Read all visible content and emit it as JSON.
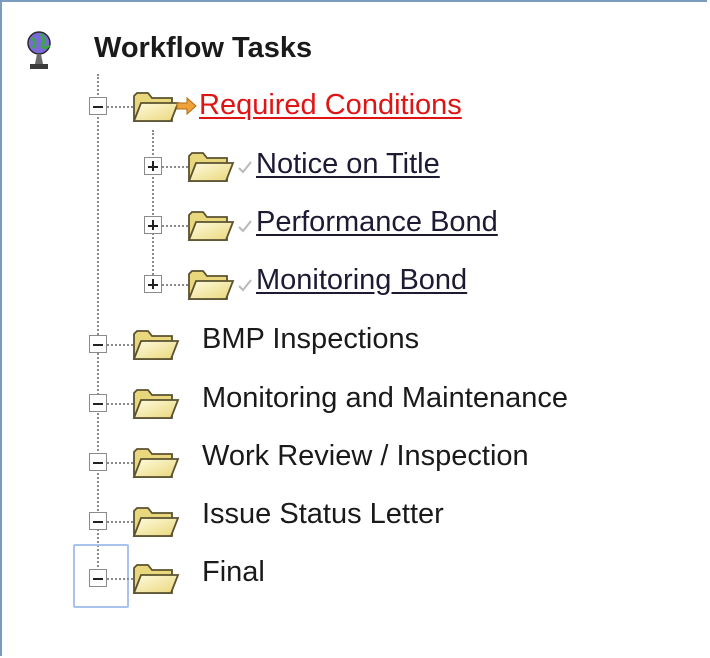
{
  "tree": {
    "root_label": "Workflow Tasks",
    "root_icon": "globe-icon",
    "items": [
      {
        "label": "Required Conditions",
        "state": "expanded",
        "active": true,
        "link": true
      },
      {
        "label": "Notice on Title",
        "state": "collapsed",
        "link": true,
        "child": true
      },
      {
        "label": "Performance Bond",
        "state": "collapsed",
        "link": true,
        "child": true
      },
      {
        "label": "Monitoring Bond",
        "state": "collapsed",
        "link": true,
        "child": true
      },
      {
        "label": "BMP Inspections",
        "state": "expanded",
        "link": false
      },
      {
        "label": "Monitoring and Maintenance",
        "state": "expanded",
        "link": false
      },
      {
        "label": "Work Review / Inspection",
        "state": "expanded",
        "link": false
      },
      {
        "label": "Issue Status Letter",
        "state": "expanded",
        "link": false
      },
      {
        "label": "Final",
        "state": "expanded",
        "link": false,
        "focused": true
      }
    ]
  },
  "colors": {
    "active_link": "#e01414",
    "link": "#1d1a33",
    "border": "#7a9cc0",
    "focus": "#a8c4ee",
    "folder": "#f3e89a"
  }
}
